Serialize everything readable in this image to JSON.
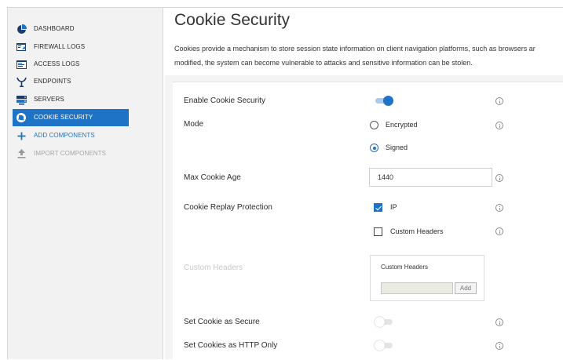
{
  "sidebar": {
    "items": [
      {
        "label": "DASHBOARD",
        "icon": "pie-chart-icon"
      },
      {
        "label": "FIREWALL LOGS",
        "icon": "firewall-logs-icon"
      },
      {
        "label": "ACCESS LOGS",
        "icon": "access-logs-icon"
      },
      {
        "label": "ENDPOINTS",
        "icon": "endpoint-icon"
      },
      {
        "label": "SERVERS",
        "icon": "server-icon"
      },
      {
        "label": "COOKIE SECURITY",
        "icon": "cookie-icon",
        "active": true
      },
      {
        "label": "ADD COMPONENTS",
        "icon": "plus-icon"
      },
      {
        "label": "IMPORT COMPONENTS",
        "icon": "upload-icon",
        "disabled": true
      }
    ]
  },
  "page": {
    "title": "Cookie Security",
    "description_line1": "Cookies provide a mechanism to store session state information on client navigation platforms, such as browsers ar",
    "description_line2": "modified, the system can become vulnerable to attacks and sensitive information can be stolen."
  },
  "form": {
    "enable_cookie_security": {
      "label": "Enable Cookie Security",
      "value": true
    },
    "mode": {
      "label": "Mode",
      "options": [
        "Encrypted",
        "Signed"
      ],
      "selected": "Signed"
    },
    "max_cookie_age": {
      "label": "Max Cookie Age",
      "value": "1440"
    },
    "cookie_replay_protection": {
      "label": "Cookie Replay Protection",
      "options": [
        {
          "label": "IP",
          "checked": true
        },
        {
          "label": "Custom Headers",
          "checked": false
        }
      ]
    },
    "custom_headers": {
      "label": "Custom Headers",
      "box_title": "Custom Headers",
      "input_value": "",
      "add_label": "Add"
    },
    "set_cookie_secure": {
      "label": "Set Cookie as Secure",
      "value": false
    },
    "set_cookie_http_only": {
      "label": "Set Cookies as HTTP Only",
      "value": false
    }
  },
  "colors": {
    "accent": "#1f73c6",
    "sidebar_bg": "#f2f2f2"
  }
}
